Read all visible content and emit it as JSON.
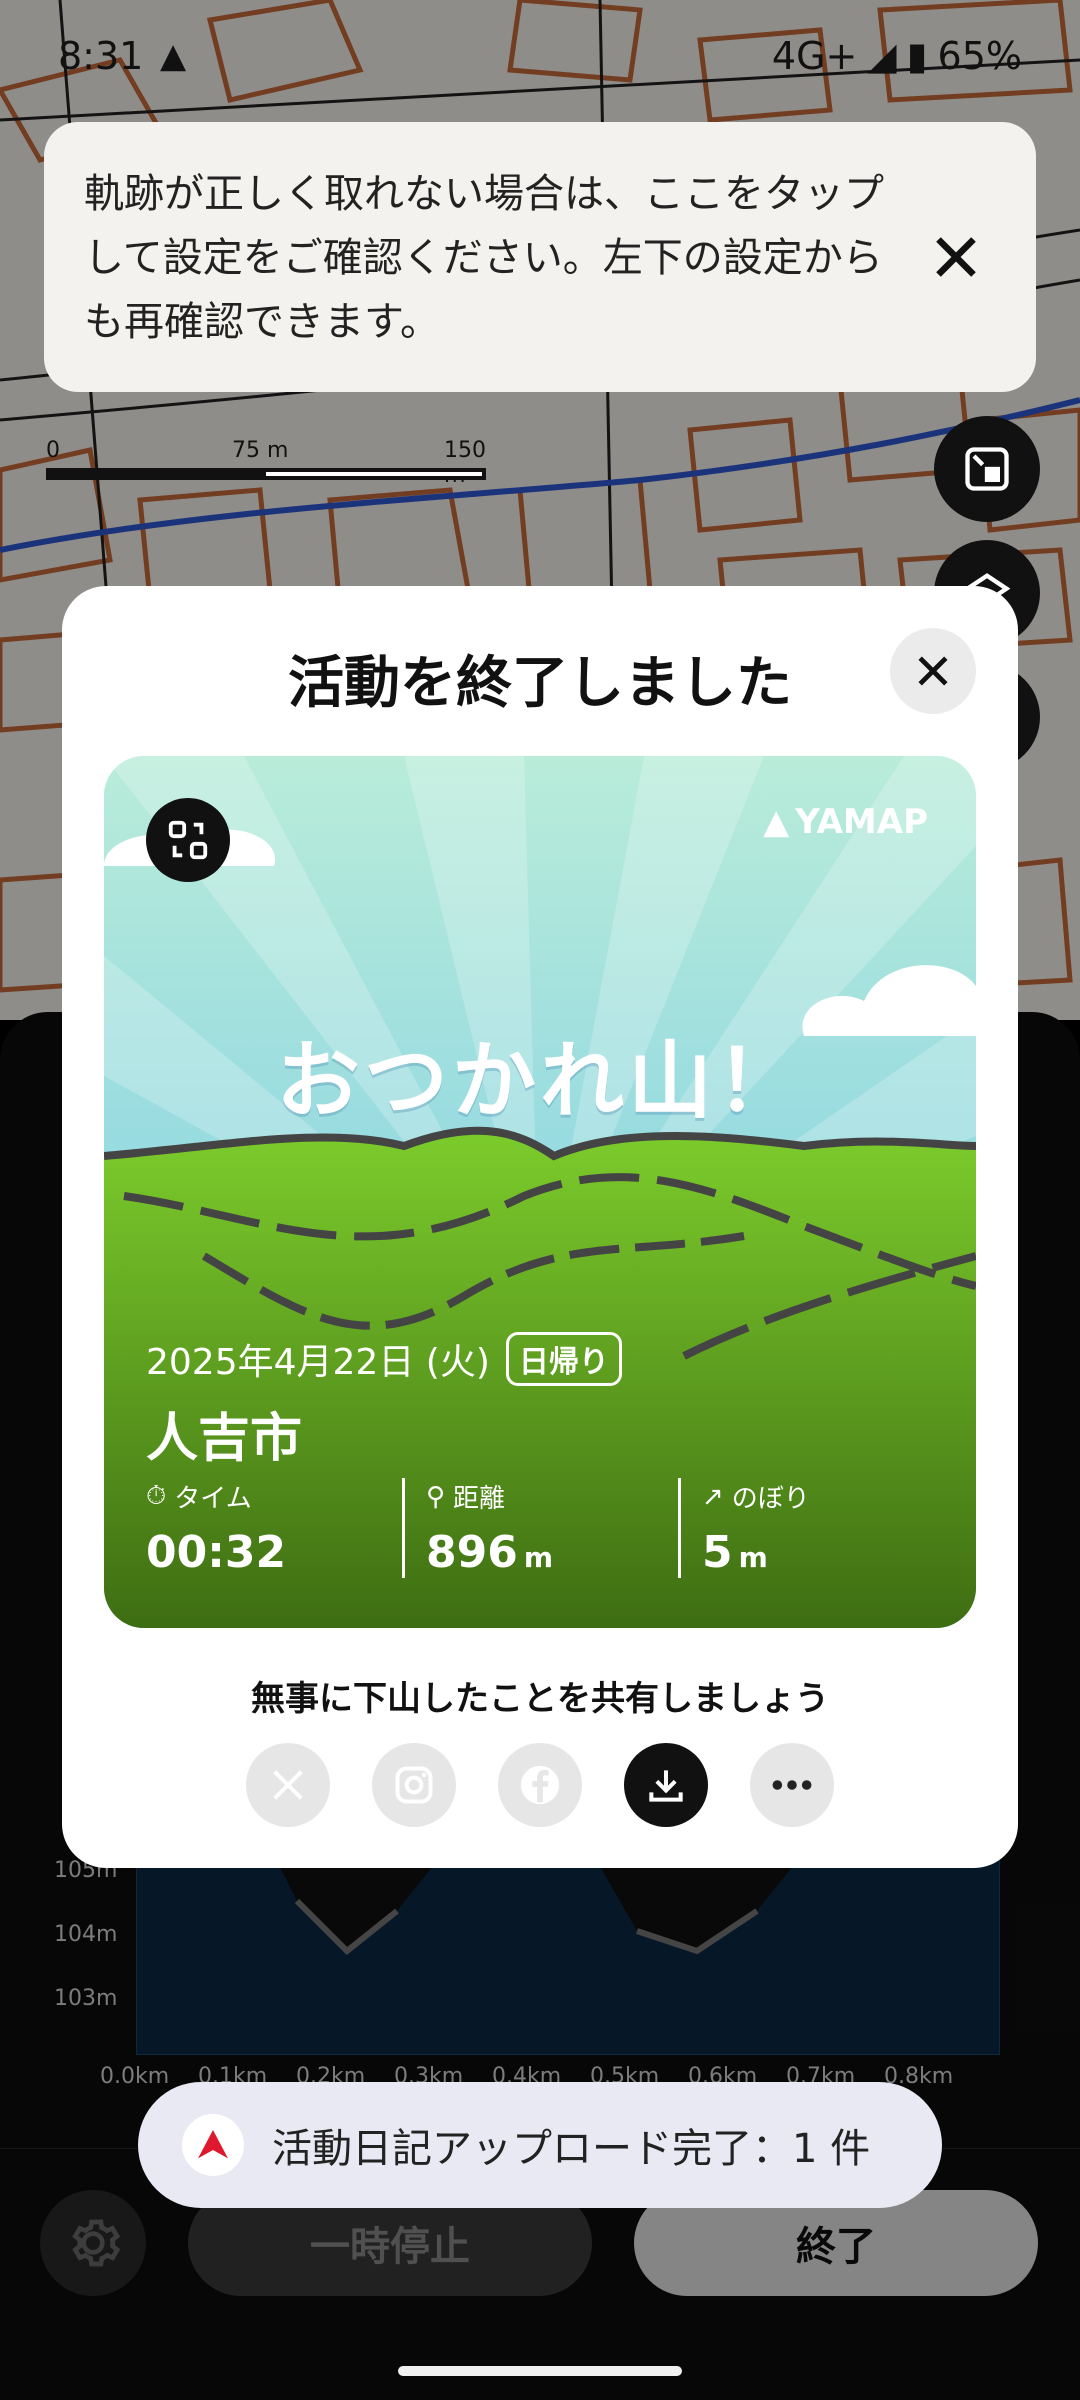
{
  "status_bar": {
    "time": "8:31",
    "network": "4G+",
    "battery": "65%"
  },
  "banner": {
    "message": "軌跡が正しく取れない場合は、ここをタップして設定をご確認ください。左下の設定からも再確認できます。",
    "close_icon": "close-icon"
  },
  "map": {
    "scale_labels": [
      "0",
      "75 m",
      "150 m"
    ]
  },
  "modal": {
    "title": "活動を終了しました",
    "card": {
      "logo": "YAMAP",
      "headline": "おつかれ山！",
      "date": "2025年4月22日 (火)",
      "tag": "日帰り",
      "place": "人吉市",
      "stats": [
        {
          "label": "タイム",
          "value": "00:32",
          "unit": ""
        },
        {
          "label": "距離",
          "value": "896",
          "unit": "m"
        },
        {
          "label": "のぼり",
          "value": "5",
          "unit": "m"
        }
      ]
    },
    "share_text": "無事に下山したことを共有しましょう",
    "share_buttons": [
      "x-icon",
      "instagram-icon",
      "facebook-icon",
      "download-icon",
      "more-icon"
    ]
  },
  "chart": {
    "y_ticks": [
      "105m",
      "104m",
      "103m"
    ],
    "x_ticks": [
      "0.0km",
      "0.1km",
      "0.2km",
      "0.3km",
      "0.4km",
      "0.5km",
      "0.6km",
      "0.7km",
      "0.8km"
    ]
  },
  "controls": {
    "pause_label": "一時停止",
    "end_label": "終了"
  },
  "toast": {
    "message": "活動日記アップロード完了：1 件"
  }
}
